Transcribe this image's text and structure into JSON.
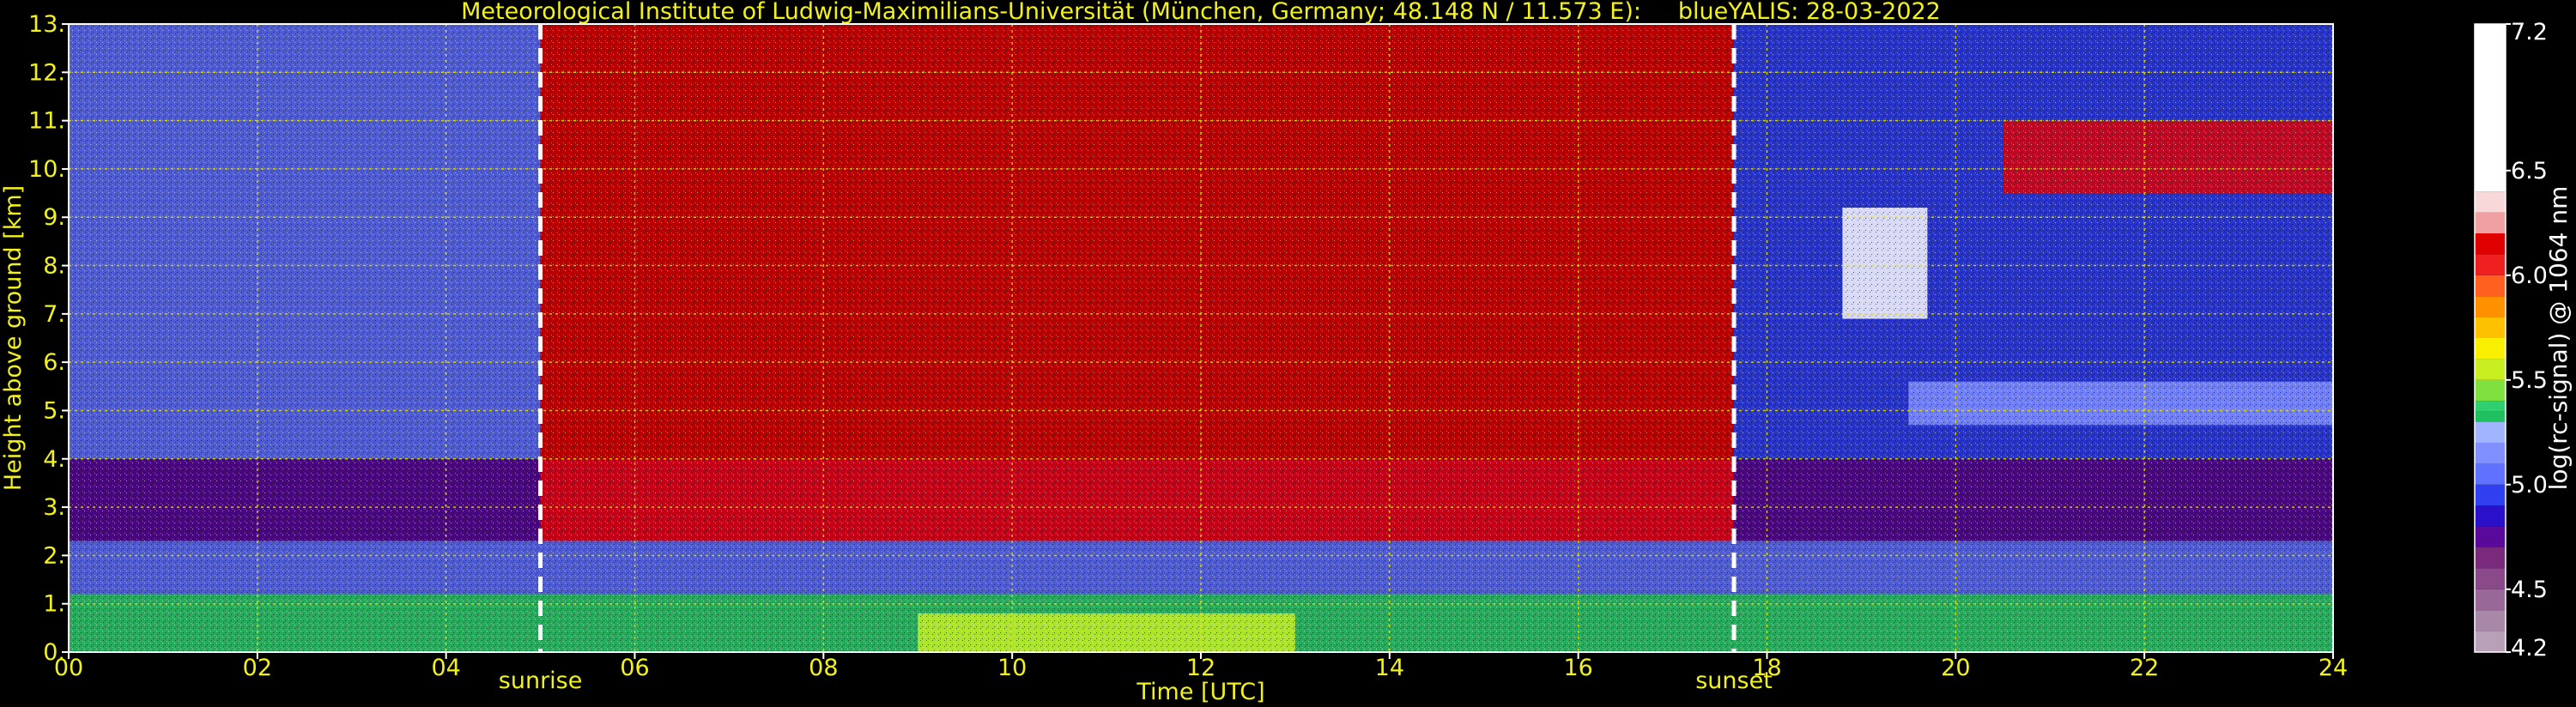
{
  "chart_data": {
    "type": "heatmap",
    "title": "Meteorological Institute of Ludwig-Maximilians-Universität (München, Germany; 48.148 N / 11.573 E):     blueYALIS: 28-03-2022",
    "xlabel": "Time [UTC]",
    "ylabel": "Height above ground [km]",
    "xlim": [
      0,
      24
    ],
    "ylim": [
      0,
      13
    ],
    "x_ticks": [
      "00",
      "02",
      "04",
      "06",
      "08",
      "10",
      "12",
      "14",
      "16",
      "18",
      "20",
      "22",
      "24"
    ],
    "x_tick_values": [
      0,
      2,
      4,
      6,
      8,
      10,
      12,
      14,
      16,
      18,
      20,
      22,
      24
    ],
    "y_ticks": [
      "0.",
      "1.",
      "2.",
      "3.",
      "4.",
      "5.",
      "6.",
      "7.",
      "8.",
      "9.",
      "10.",
      "11.",
      "12.",
      "13."
    ],
    "y_tick_values": [
      0,
      1,
      2,
      3,
      4,
      5,
      6,
      7,
      8,
      9,
      10,
      11,
      12,
      13
    ],
    "grid": true,
    "vertical_markers": [
      {
        "label": "sunrise",
        "x": 5.0
      },
      {
        "label": "sunset",
        "x": 17.65
      }
    ],
    "colorbar": {
      "label": "log(rc-signal) @ 1064 nm",
      "range": [
        4.2,
        7.2
      ],
      "ticks": [
        "4.2",
        "4.5",
        "5.0",
        "5.5",
        "6.0",
        "6.5",
        "7.2"
      ],
      "tick_values": [
        4.2,
        4.5,
        5.0,
        5.5,
        6.0,
        6.5,
        7.2
      ],
      "colors": [
        {
          "from": 4.2,
          "to": 4.3,
          "color": "#b8a0b8"
        },
        {
          "from": 4.3,
          "to": 4.4,
          "color": "#a888a8"
        },
        {
          "from": 4.4,
          "to": 4.5,
          "color": "#986898"
        },
        {
          "from": 4.5,
          "to": 4.6,
          "color": "#8a4a8a"
        },
        {
          "from": 4.6,
          "to": 4.7,
          "color": "#7a2a7a"
        },
        {
          "from": 4.7,
          "to": 4.8,
          "color": "#5a0a9a"
        },
        {
          "from": 4.8,
          "to": 4.9,
          "color": "#2a10c8"
        },
        {
          "from": 4.9,
          "to": 5.0,
          "color": "#3040f0"
        },
        {
          "from": 5.0,
          "to": 5.1,
          "color": "#6070ff"
        },
        {
          "from": 5.1,
          "to": 5.2,
          "color": "#8090ff"
        },
        {
          "from": 5.2,
          "to": 5.3,
          "color": "#a0b4ff"
        },
        {
          "from": 5.3,
          "to": 5.35,
          "color": "#20c060"
        },
        {
          "from": 5.35,
          "to": 5.4,
          "color": "#30d070"
        },
        {
          "from": 5.4,
          "to": 5.5,
          "color": "#80e040"
        },
        {
          "from": 5.5,
          "to": 5.6,
          "color": "#c8f020"
        },
        {
          "from": 5.6,
          "to": 5.7,
          "color": "#f8f000"
        },
        {
          "from": 5.7,
          "to": 5.8,
          "color": "#ffc000"
        },
        {
          "from": 5.8,
          "to": 5.9,
          "color": "#ff9000"
        },
        {
          "from": 5.9,
          "to": 6.0,
          "color": "#ff6020"
        },
        {
          "from": 6.0,
          "to": 6.1,
          "color": "#f02020"
        },
        {
          "from": 6.1,
          "to": 6.2,
          "color": "#e00000"
        },
        {
          "from": 6.2,
          "to": 6.3,
          "color": "#f0a0a0"
        },
        {
          "from": 6.3,
          "to": 6.4,
          "color": "#f8d8d8"
        },
        {
          "from": 6.4,
          "to": 7.2,
          "color": "#ffffff"
        }
      ]
    },
    "layers": [
      {
        "x": [
          0,
          24
        ],
        "y": [
          0,
          1.2
        ],
        "value": 5.35
      },
      {
        "x": [
          0,
          24
        ],
        "y": [
          1.2,
          2.3
        ],
        "value": 5.0
      },
      {
        "x": [
          0,
          24
        ],
        "y": [
          2.3,
          4.0
        ],
        "value": 4.7
      },
      {
        "x": [
          0,
          5
        ],
        "y": [
          4.0,
          13
        ],
        "value": 5.0
      },
      {
        "x": [
          5,
          17.65
        ],
        "y": [
          2.3,
          13
        ],
        "value": 6.1
      },
      {
        "x": [
          17.65,
          24
        ],
        "y": [
          4.0,
          13
        ],
        "value": 4.9
      },
      {
        "x": [
          9,
          13
        ],
        "y": [
          0,
          0.8
        ],
        "value": 5.55
      },
      {
        "x": [
          19.5,
          24
        ],
        "y": [
          4.7,
          5.6
        ],
        "value": 5.1
      },
      {
        "x": [
          20.5,
          24
        ],
        "y": [
          9.5,
          11.0
        ],
        "value": 6.1
      },
      {
        "x": [
          18.8,
          19.7
        ],
        "y": [
          6.9,
          9.2
        ],
        "value": 6.5
      }
    ]
  }
}
